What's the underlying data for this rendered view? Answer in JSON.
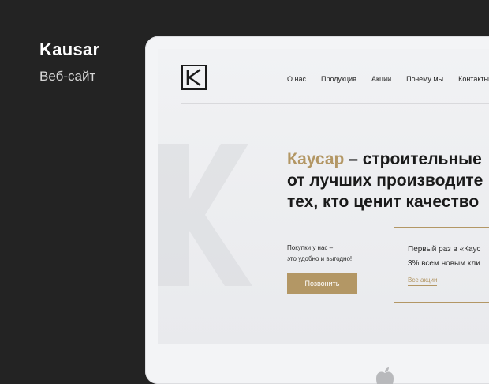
{
  "brand": {
    "title": "Kausar",
    "subtitle": "Веб-сайт"
  },
  "site": {
    "logo_letter": "K",
    "nav": [
      "О нас",
      "Продукция",
      "Акции",
      "Почему мы",
      "Контакты"
    ],
    "headline": {
      "accent": "Каусар",
      "line1_rest": " – строительные ",
      "line2": "от лучших производите",
      "line3": "тех, кто ценит качество"
    },
    "promo": {
      "line1": "Покупки у нас –",
      "line2": "это удобно и выгодно!",
      "button": "Позвонить"
    },
    "offer": {
      "line1": "Первый раз в «Каус",
      "line2": "3% всем новым кли",
      "link": "Все акции"
    }
  },
  "colors": {
    "accent": "#b39765",
    "background": "#232323",
    "text": "#1a1a1a"
  },
  "icons": {
    "device": "apple-logo-icon"
  }
}
